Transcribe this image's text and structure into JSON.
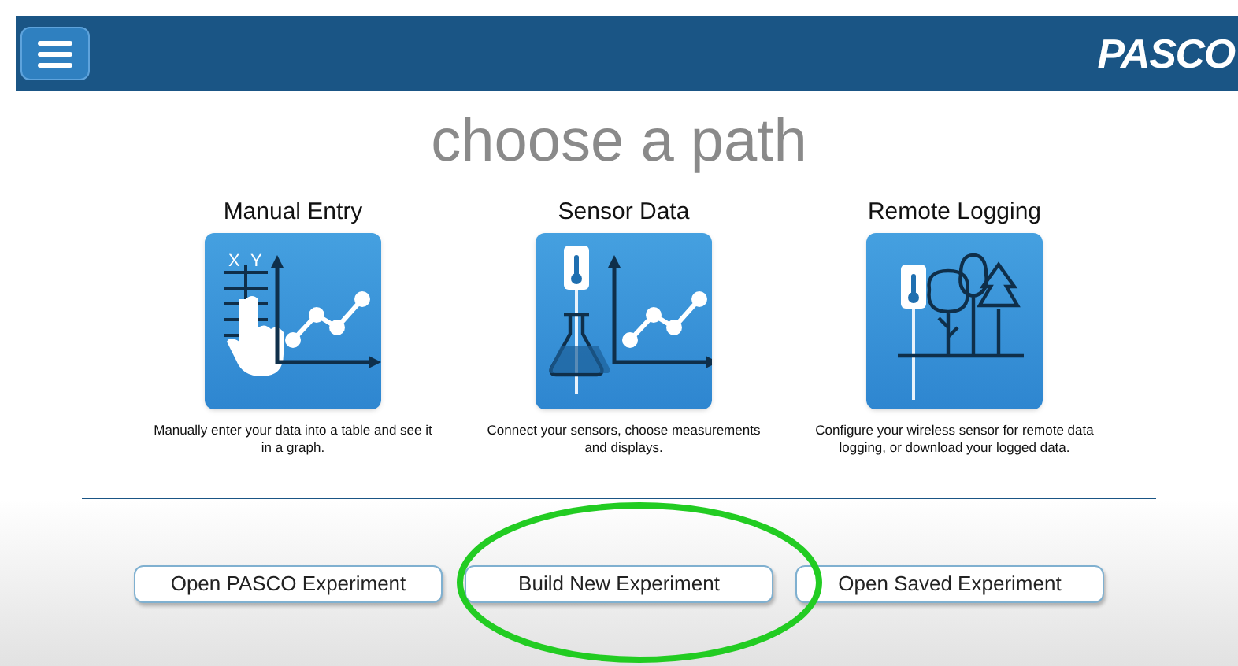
{
  "header": {
    "logo": "PASCO"
  },
  "title": "choose a path",
  "paths": [
    {
      "kind": "manual",
      "title": "Manual Entry",
      "axis_x": "X",
      "axis_y": "Y",
      "description": "Manually enter your data into a table and see it in a graph."
    },
    {
      "kind": "sensor",
      "title": "Sensor Data",
      "description": "Connect your sensors, choose measurements and displays."
    },
    {
      "kind": "remote",
      "title": "Remote Logging",
      "description": "Configure your wireless sensor for remote data logging, or download your logged data."
    }
  ],
  "buttons": [
    "Open PASCO Experiment",
    "Build New Experiment",
    "Open Saved Experiment"
  ],
  "annotation": {
    "kind": "ellipse"
  }
}
